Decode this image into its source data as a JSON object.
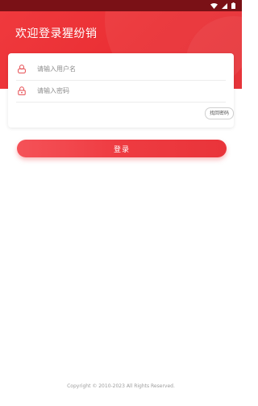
{
  "status_bar": {
    "icons": [
      "wifi-icon",
      "signal-icon",
      "battery-icon"
    ]
  },
  "header": {
    "welcome_text": "欢迎登录猩纷销"
  },
  "login_form": {
    "username": {
      "placeholder": "请输入用户名",
      "value": "",
      "icon": "user-icon"
    },
    "password": {
      "placeholder": "请输入密码",
      "value": "",
      "icon": "lock-icon"
    },
    "forgot_label": "找回密码",
    "login_label": "登录"
  },
  "footer": {
    "copyright": "Copyright © 2010-2023  All Rights Reserved."
  },
  "colors": {
    "primary": "#ee3b41",
    "status_bar": "#7a1116"
  }
}
